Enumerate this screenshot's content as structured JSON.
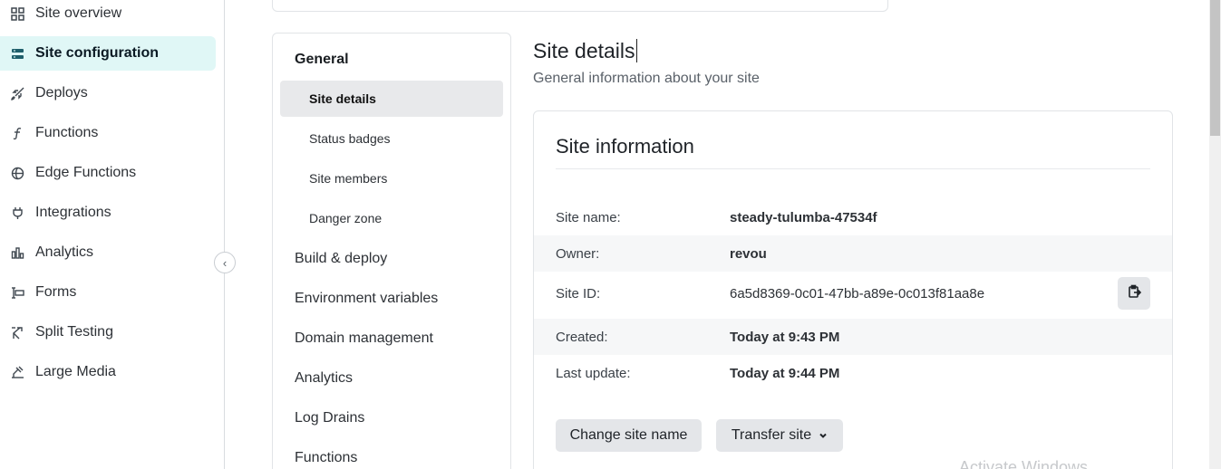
{
  "sidebar": {
    "items": [
      {
        "label": "Site overview",
        "icon": "grid-icon"
      },
      {
        "label": "Site configuration",
        "icon": "server-icon",
        "active": true
      },
      {
        "label": "Deploys",
        "icon": "rocket-icon"
      },
      {
        "label": "Functions",
        "icon": "function-icon"
      },
      {
        "label": "Edge Functions",
        "icon": "globe-icon"
      },
      {
        "label": "Integrations",
        "icon": "plug-icon"
      },
      {
        "label": "Analytics",
        "icon": "bar-chart-icon"
      },
      {
        "label": "Forms",
        "icon": "form-icon"
      },
      {
        "label": "Split Testing",
        "icon": "split-icon"
      },
      {
        "label": "Large Media",
        "icon": "media-icon"
      }
    ],
    "collapse_glyph": "‹"
  },
  "subnav": {
    "general": "General",
    "general_items": [
      "Site details",
      "Status badges",
      "Site members",
      "Danger zone"
    ],
    "sections": [
      "Build & deploy",
      "Environment variables",
      "Domain management",
      "Analytics",
      "Log Drains",
      "Functions"
    ]
  },
  "main": {
    "title": "Site details",
    "subtitle": "General information about your site",
    "card": {
      "title": "Site information",
      "rows": [
        {
          "key": "Site name:",
          "value": "steady-tulumba-47534f"
        },
        {
          "key": "Owner:",
          "value": "revou"
        },
        {
          "key": "Site ID:",
          "value": "6a5d8369-0c01-47bb-a89e-0c013f81aa8e"
        },
        {
          "key": "Created:",
          "value": "Today at 9:43 PM"
        },
        {
          "key": "Last update:",
          "value": "Today at 9:44 PM"
        }
      ],
      "change_name_label": "Change site name",
      "transfer_label": "Transfer site"
    }
  },
  "watermark": "Activate Windows",
  "colors": {
    "active_nav_bg": "#e0f7f6",
    "button_bg": "#e4e6e9",
    "row_shade": "#f6f7f8"
  }
}
